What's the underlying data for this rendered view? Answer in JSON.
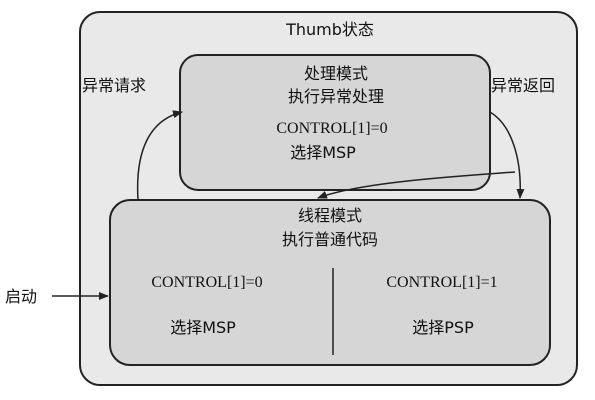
{
  "outer_state": {
    "title": "Thumb状态"
  },
  "handler_mode": {
    "title": "处理模式",
    "subtitle": "执行异常处理",
    "control": "CONTROL[1]=0",
    "stack": "选择MSP"
  },
  "thread_mode": {
    "title": "线程模式",
    "subtitle": "执行普通代码",
    "left": {
      "control": "CONTROL[1]=0",
      "stack": "选择MSP"
    },
    "right": {
      "control": "CONTROL[1]=1",
      "stack": "选择PSP"
    }
  },
  "transitions": {
    "exception_request": "异常请求",
    "exception_return": "异常返回",
    "startup": "启动"
  },
  "colors": {
    "outer_fill": "#e9e9e9",
    "box_fill": "#d6d6d6",
    "stroke": "#222222"
  }
}
